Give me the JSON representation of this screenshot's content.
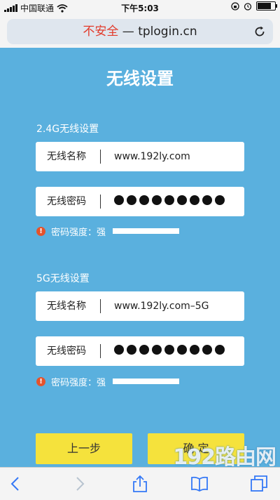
{
  "status_bar": {
    "carrier": "中国联通",
    "time": "下午5:03",
    "battery_level": 0.85
  },
  "address_bar": {
    "insecure_label": "不安全",
    "dash": "—",
    "domain": "tplogin.cn"
  },
  "page": {
    "title": "无线设置"
  },
  "sections": [
    {
      "title": "2.4G无线设置",
      "ssid_label": "无线名称",
      "ssid_value": "www.192ly.com",
      "password_label": "无线密码",
      "password_mask_count": 9,
      "strength_text": "密码强度：强"
    },
    {
      "title": "5G无线设置",
      "ssid_label": "无线名称",
      "ssid_value": "www.192ly.com–5G",
      "password_label": "无线密码",
      "password_mask_count": 9,
      "strength_text": "密码强度：强"
    }
  ],
  "buttons": {
    "prev_label": "上一步",
    "confirm_label": "确 定"
  },
  "watermark": "192路由网",
  "icons": {
    "warning": "!",
    "back": "back-icon",
    "forward": "forward-icon",
    "share": "share-icon",
    "bookmarks": "book-icon",
    "tabs": "tabs-icon"
  },
  "colors": {
    "background": "#5ab0de",
    "button": "#f5e23c",
    "insecure": "#e23a2a",
    "warning": "#e4532c"
  }
}
